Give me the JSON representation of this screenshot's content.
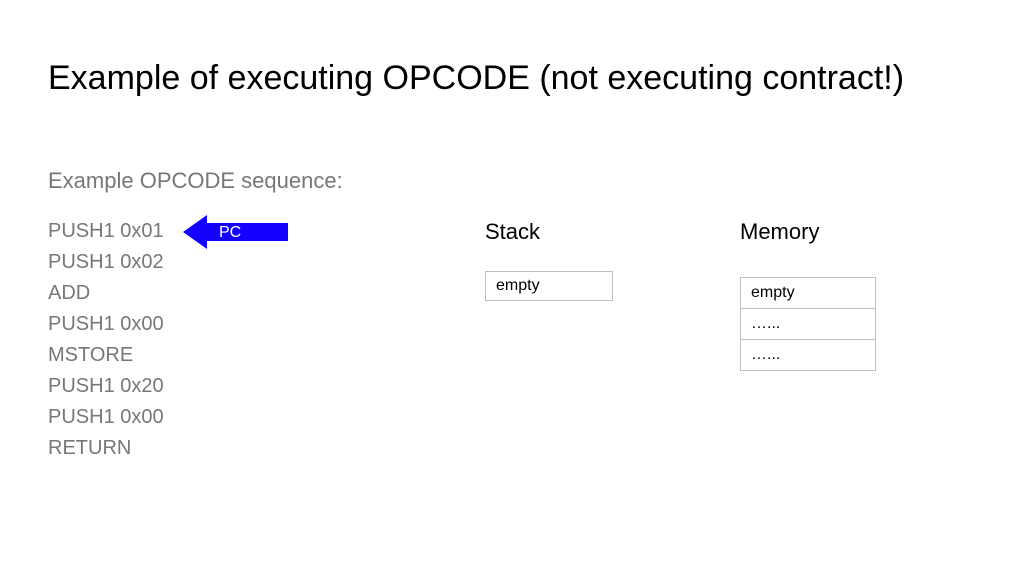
{
  "title": "Example of executing OPCODE (not executing contract!)",
  "subtitle": "Example OPCODE sequence:",
  "opcodes": [
    "PUSH1 0x01",
    "PUSH1 0x02",
    "ADD",
    "PUSH1 0x00",
    "MSTORE",
    "PUSH1 0x20",
    "PUSH1 0x00",
    "RETURN"
  ],
  "pc": {
    "label": "PC",
    "points_to_index": 0,
    "color": "#1400ff"
  },
  "stack": {
    "label": "Stack",
    "cells": [
      "empty"
    ]
  },
  "memory": {
    "label": "Memory",
    "cells": [
      "empty",
      "…...",
      "…..."
    ]
  }
}
